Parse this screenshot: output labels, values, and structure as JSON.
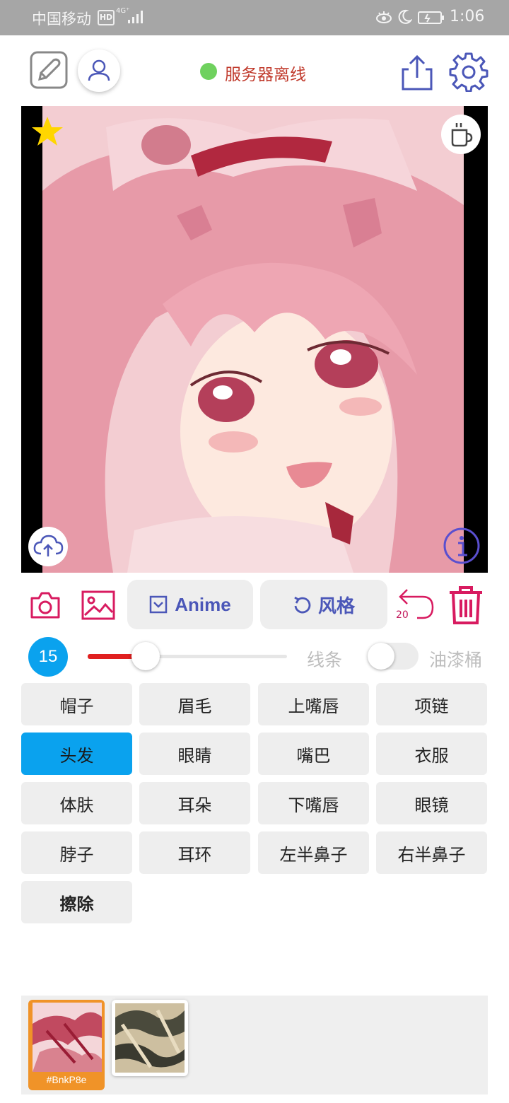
{
  "status_bar": {
    "carrier": "中国移动",
    "hd_badge": "HD",
    "network": "4G⁺",
    "time": "1:06"
  },
  "header": {
    "server_status": "服务器离线",
    "server_status_color": "#6fd15e"
  },
  "actions": {
    "anime_label": "Anime",
    "style_label": "风格",
    "undo_count": "20"
  },
  "brush": {
    "size": "15",
    "lines_label": "线条",
    "bucket_label": "油漆桶",
    "slider_level": 0.3,
    "bucket_enabled": false
  },
  "parts": [
    {
      "label": "帽子"
    },
    {
      "label": "眉毛"
    },
    {
      "label": "上嘴唇"
    },
    {
      "label": "项链"
    },
    {
      "label": "头发",
      "selected": true
    },
    {
      "label": "眼睛"
    },
    {
      "label": "嘴巴"
    },
    {
      "label": "衣服"
    },
    {
      "label": "体肤"
    },
    {
      "label": "耳朵"
    },
    {
      "label": "下嘴唇"
    },
    {
      "label": "眼镜"
    },
    {
      "label": "脖子"
    },
    {
      "label": "耳环"
    },
    {
      "label": "左半鼻子"
    },
    {
      "label": "右半鼻子"
    },
    {
      "label": "擦除"
    }
  ],
  "history": {
    "thumb1_label": "#BnkP8e"
  },
  "colors": {
    "accent_blue": "#0aa2ee",
    "icon_purple": "#4b57b8",
    "icon_red": "#d81b60"
  }
}
